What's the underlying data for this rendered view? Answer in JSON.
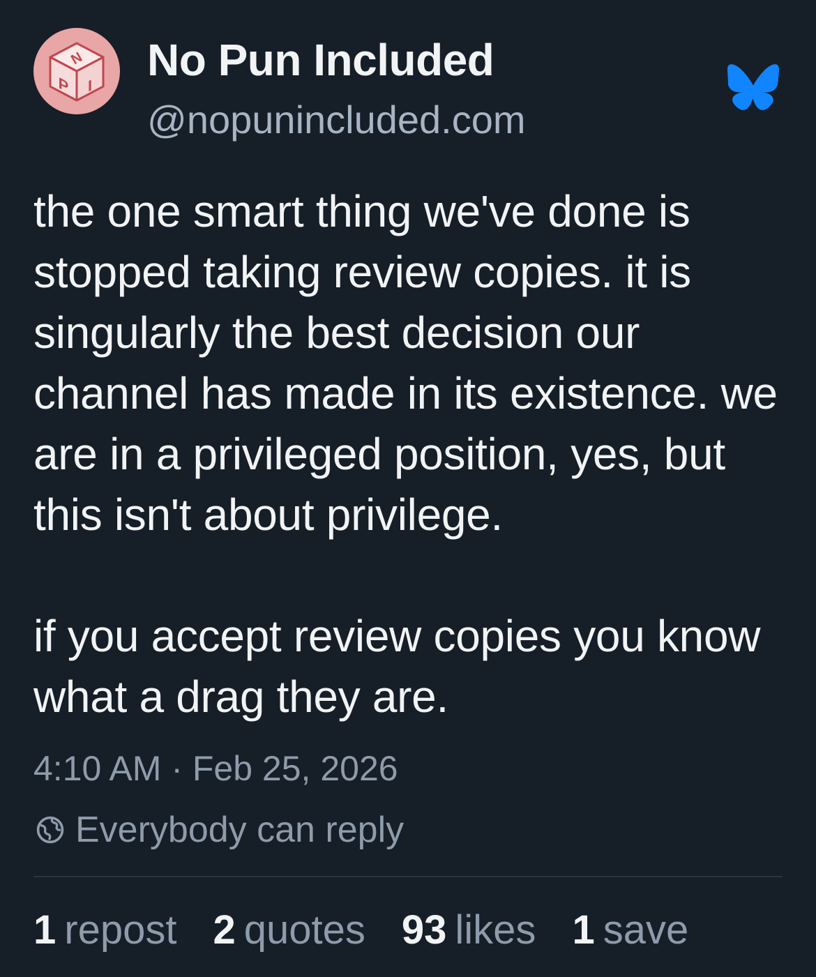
{
  "author": {
    "display_name": "No Pun Included",
    "handle": "@nopunincluded.com",
    "avatar_letters": [
      "N",
      "P",
      "I"
    ],
    "avatar_color": "#e9a6a6"
  },
  "post": {
    "text": "the one smart thing we've done is stopped taking review copies. it is singularly the best decision our channel has made in its existence. we are in a privileged position, yes, but this isn't about privilege.\n\nif you accept review copies you know what a drag they are.",
    "timestamp": "4:10 AM · Feb 25, 2026",
    "reply_setting": "Everybody can reply"
  },
  "stats": [
    {
      "count": "1",
      "label": "repost"
    },
    {
      "count": "2",
      "label": "quotes"
    },
    {
      "count": "93",
      "label": "likes"
    },
    {
      "count": "1",
      "label": "save"
    }
  ],
  "colors": {
    "background": "#161e27",
    "text_primary": "#f1f3f5",
    "text_secondary": "#8e9bab",
    "bluesky_brand": "#1185fe"
  },
  "icons": {
    "platform": "bluesky-butterfly-icon",
    "reply_setting": "globe-icon"
  }
}
